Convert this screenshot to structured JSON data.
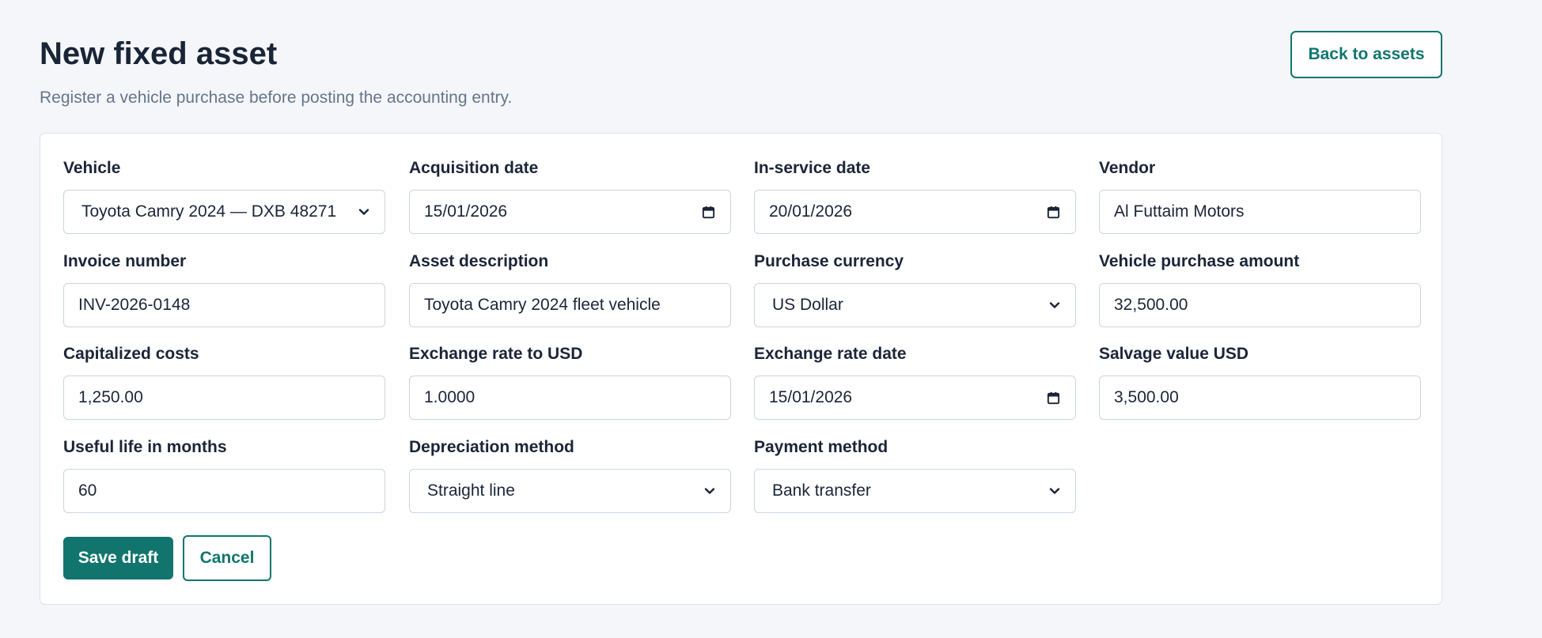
{
  "header": {
    "title": "New fixed asset",
    "subtitle": "Register a vehicle purchase before posting the accounting entry.",
    "back_label": "Back to assets"
  },
  "form": {
    "vehicle": {
      "label": "Vehicle",
      "value": "Toyota Camry 2024 — DXB 48271"
    },
    "acquisition_date": {
      "label": "Acquisition date",
      "value": "15/01/2026"
    },
    "in_service_date": {
      "label": "In-service date",
      "value": "20/01/2026"
    },
    "vendor": {
      "label": "Vendor",
      "value": "Al Futtaim Motors"
    },
    "invoice_number": {
      "label": "Invoice number",
      "value": "INV-2026-0148"
    },
    "asset_description": {
      "label": "Asset description",
      "value": "Toyota Camry 2024 fleet vehicle"
    },
    "purchase_currency": {
      "label": "Purchase currency",
      "value": "US Dollar"
    },
    "vehicle_purchase_amount": {
      "label": "Vehicle purchase amount",
      "value": "32,500.00"
    },
    "capitalized_costs": {
      "label": "Capitalized costs",
      "value": "1,250.00"
    },
    "exchange_rate_to_usd": {
      "label": "Exchange rate to USD",
      "value": "1.0000"
    },
    "exchange_rate_date": {
      "label": "Exchange rate date",
      "value": "15/01/2026"
    },
    "salvage_value_usd": {
      "label": "Salvage value USD",
      "value": "3,500.00"
    },
    "useful_life_months": {
      "label": "Useful life in months",
      "value": "60"
    },
    "depreciation_method": {
      "label": "Depreciation method",
      "value": "Straight line"
    },
    "payment_method": {
      "label": "Payment method",
      "value": "Bank transfer"
    }
  },
  "actions": {
    "save_label": "Save draft",
    "cancel_label": "Cancel"
  },
  "icons": {
    "select_arrow": "chevron-down-icon",
    "date_picker": "calendar-icon"
  },
  "colors": {
    "accent": "#11756e",
    "background": "#f4f6f9",
    "title": "#1a2437",
    "subtitle": "#66758b",
    "border": "#cdd4df"
  }
}
